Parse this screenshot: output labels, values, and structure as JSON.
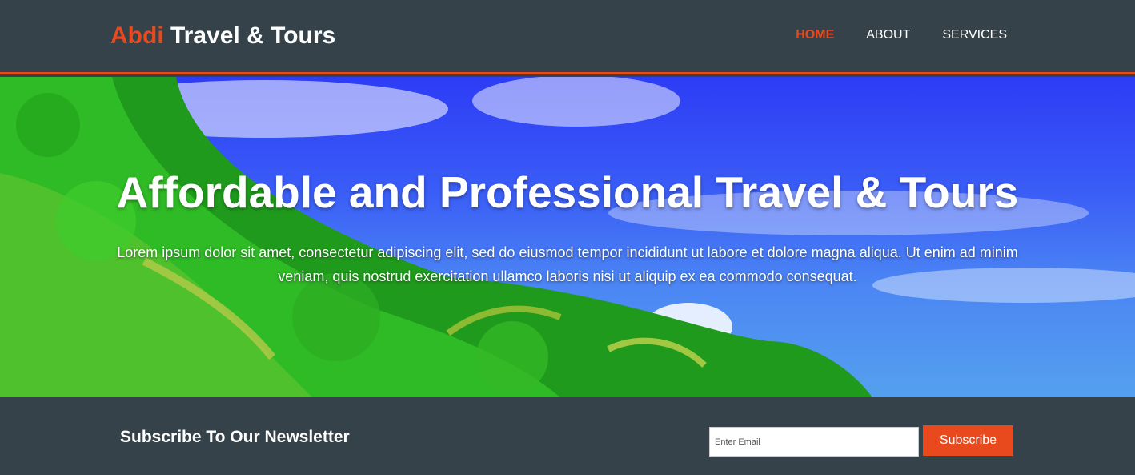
{
  "header": {
    "brand_highlight": "Abdi",
    "brand_rest": "Travel & Tours",
    "nav": [
      {
        "label": "HOME",
        "active": true
      },
      {
        "label": "ABOUT",
        "active": false
      },
      {
        "label": "SERVICES",
        "active": false
      }
    ]
  },
  "hero": {
    "title": "Affordable and Professional Travel & Tours",
    "text": "Lorem ipsum dolor sit amet, consectetur adipiscing elit, sed do eiusmod tempor incididunt ut labore et dolore magna aliqua. Ut enim ad minim veniam, quis nostrud exercitation ullamco laboris nisi ut aliquip ex ea commodo consequat."
  },
  "newsletter": {
    "heading": "Subscribe To Our Newsletter",
    "email_placeholder": "Enter Email",
    "email_value": "",
    "button_label": "Subscribe"
  },
  "colors": {
    "dark_bg": "#35424a",
    "accent": "#e8491d",
    "sky": "#3a5cf6",
    "foliage": "#2fae2a"
  }
}
